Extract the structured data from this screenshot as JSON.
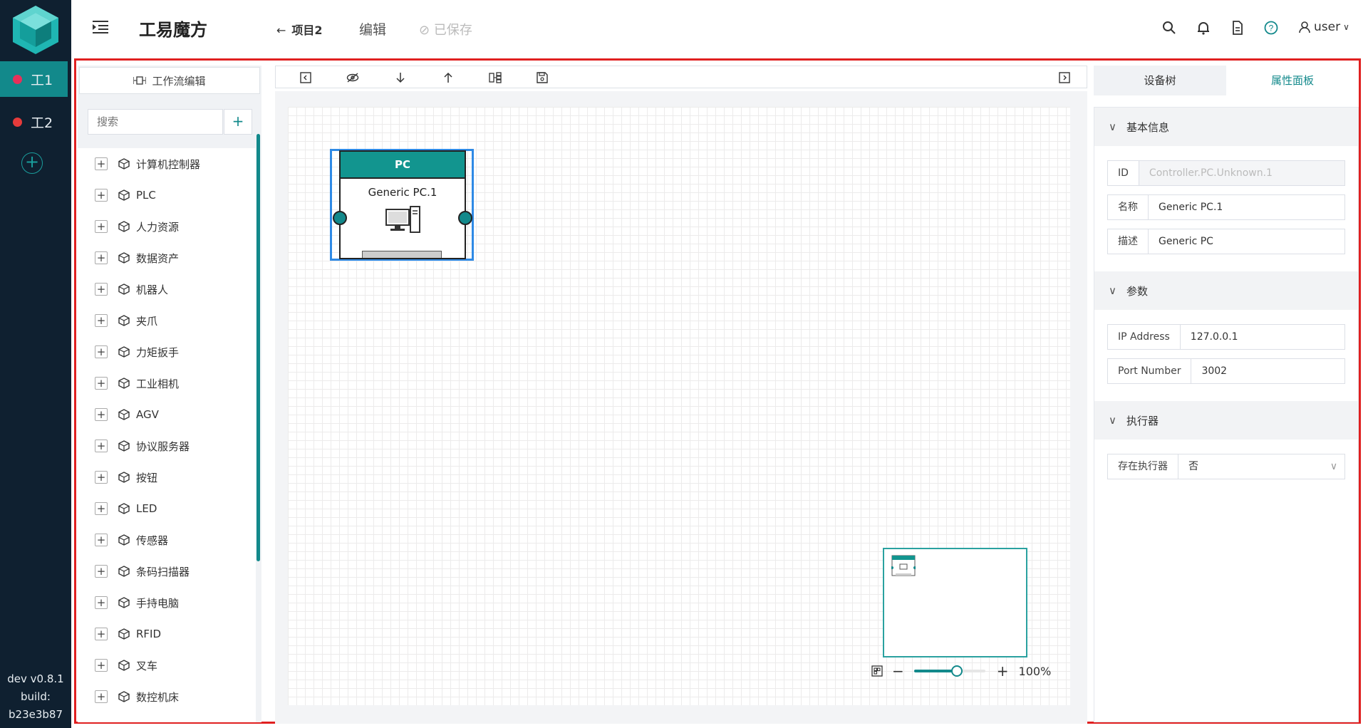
{
  "app": {
    "title": "工易魔方"
  },
  "rail": {
    "tabs": [
      {
        "label": "工1",
        "dot_color": "#e8305a",
        "active": true
      },
      {
        "label": "工2",
        "dot_color": "#e63b3b",
        "active": false
      }
    ],
    "add_symbol": "+",
    "version": "dev v0.8.1",
    "build_label": "build:",
    "build_id": "b23e3b87"
  },
  "header": {
    "back_label": "项目2",
    "edit_label": "编辑",
    "saved_label": "已保存",
    "user_label": "user"
  },
  "left_panel": {
    "workflow_button": "工作流编辑",
    "search_placeholder": "搜索",
    "add_symbol": "+",
    "items": [
      "计算机控制器",
      "PLC",
      "人力资源",
      "数据资产",
      "机器人",
      "夹爪",
      "力矩扳手",
      "工业相机",
      "AGV",
      "协议服务器",
      "按钮",
      "LED",
      "传感器",
      "条码扫描器",
      "手持电脑",
      "RFID",
      "叉车",
      "数控机床"
    ]
  },
  "canvas": {
    "node": {
      "type_label": "PC",
      "name": "Generic PC.1"
    },
    "zoom_percent": "100%",
    "zoom_level": 0.6
  },
  "right_panel": {
    "tabs": [
      {
        "label": "设备树",
        "active": false
      },
      {
        "label": "属性面板",
        "active": true
      }
    ],
    "sections": {
      "basic": {
        "title": "基本信息",
        "id_label": "ID",
        "id_value": "Controller.PC.Unknown.1",
        "name_label": "名称",
        "name_value": "Generic PC.1",
        "desc_label": "描述",
        "desc_value": "Generic PC"
      },
      "params": {
        "title": "参数",
        "ip_label": "IP Address",
        "ip_value": "127.0.0.1",
        "port_label": "Port Number",
        "port_value": "3002"
      },
      "executor": {
        "title": "执行器",
        "exists_label": "存在执行器",
        "exists_value": "否"
      }
    }
  },
  "colors": {
    "accent": "#12898b",
    "rail_bg": "#0f2030",
    "frame": "#e02020",
    "selection": "#2f8ae5"
  }
}
